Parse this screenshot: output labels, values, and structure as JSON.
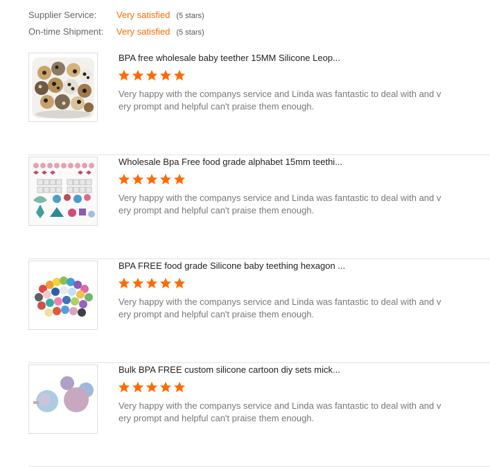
{
  "ratings": [
    {
      "label": "Supplier Service:",
      "value": "Very satisfied",
      "stars": "(5 stars)"
    },
    {
      "label": "On-time Shipment:",
      "value": "Very satisfied",
      "stars": "(5 stars)"
    }
  ],
  "reviews": [
    {
      "title": "BPA free wholesale baby teether 15MM Silicone Leop...",
      "rating": 5,
      "comment_line1": "Very happy with the companys service and Linda was fantastic to deal with and v",
      "comment_line2": "ery prompt and helpful can't praise them enough.",
      "image": "leopard-beads-jar-image"
    },
    {
      "title": "Wholesale Bpa Free food grade alphabet 15mm teethi...",
      "rating": 5,
      "comment_line1": "Very happy with the companys service and Linda was fantastic to deal with and v",
      "comment_line2": "ery prompt and helpful can't praise them enough.",
      "image": "alphabet-beads-set-image"
    },
    {
      "title": "BPA FREE food grade Silicone baby teething hexagon ...",
      "rating": 5,
      "comment_line1": "Very happy with the companys service and Linda was fantastic to deal with and v",
      "comment_line2": "ery prompt and helpful can't praise them enough.",
      "image": "hexagon-beads-pile-image"
    },
    {
      "title": "Bulk BPA FREE custom silicone cartoon diy sets mick...",
      "rating": 5,
      "comment_line1": "Very happy with the companys service and Linda was fantastic to deal with and v",
      "comment_line2": "ery prompt and helpful can't praise them enough.",
      "image": "mouse-head-beads-image"
    }
  ],
  "colors": {
    "accent": "#ff6a00",
    "divider": "#e2e2e2"
  }
}
